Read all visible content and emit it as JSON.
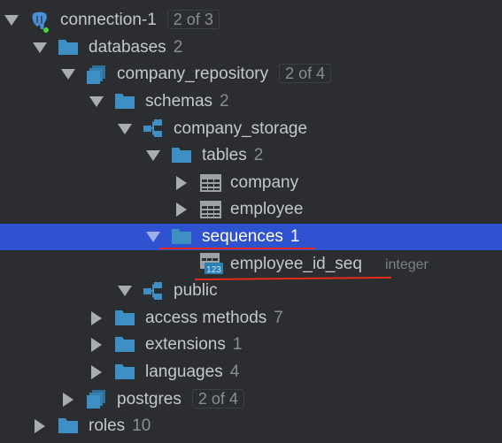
{
  "tree": [
    {
      "label": "connection-1",
      "badge": "2 of 3",
      "level": 0,
      "arrow": "down",
      "icon": "postgres-connection-icon"
    },
    {
      "label": "databases",
      "count": "2",
      "level": 1,
      "arrow": "down",
      "icon": "folder-icon"
    },
    {
      "label": "company_repository",
      "badge": "2 of 4",
      "level": 2,
      "arrow": "down",
      "icon": "database-icon"
    },
    {
      "label": "schemas",
      "count": "2",
      "level": 3,
      "arrow": "down",
      "icon": "folder-icon"
    },
    {
      "label": "company_storage",
      "level": 4,
      "arrow": "down",
      "icon": "schema-icon"
    },
    {
      "label": "tables",
      "count": "2",
      "level": 5,
      "arrow": "down",
      "icon": "folder-icon"
    },
    {
      "label": "company",
      "level": 6,
      "arrow": "right",
      "icon": "table-icon"
    },
    {
      "label": "employee",
      "level": 6,
      "arrow": "right",
      "icon": "table-icon"
    },
    {
      "label": "sequences",
      "count": "1",
      "level": 5,
      "arrow": "down",
      "icon": "folder-icon",
      "selected": true
    },
    {
      "label": "employee_id_seq",
      "type": "integer",
      "level": 6,
      "arrow": "none",
      "icon": "sequence-icon"
    },
    {
      "label": "public",
      "level": 4,
      "arrow": "down",
      "icon": "schema-icon"
    },
    {
      "label": "access methods",
      "count": "7",
      "level": 3,
      "arrow": "right",
      "icon": "folder-icon"
    },
    {
      "label": "extensions",
      "count": "1",
      "level": 3,
      "arrow": "right",
      "icon": "folder-icon"
    },
    {
      "label": "languages",
      "count": "4",
      "level": 3,
      "arrow": "right",
      "icon": "folder-icon"
    },
    {
      "label": "postgres",
      "badge": "2 of 4",
      "level": 2,
      "arrow": "right",
      "icon": "database-icon"
    },
    {
      "label": "roles",
      "count": "10",
      "level": 1,
      "arrow": "right",
      "icon": "folder-icon"
    }
  ],
  "colors": {
    "background": "#2b2d30",
    "selection": "#2f52d0",
    "icon": "#3d8fc4",
    "annotation": "#e8291c"
  }
}
